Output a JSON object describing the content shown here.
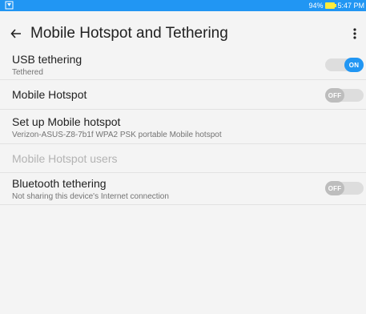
{
  "status_bar": {
    "battery": "94%",
    "time": "5:47 PM",
    "colors": {
      "background": "#2196f3",
      "battery": "#ffeb3b"
    }
  },
  "app_bar": {
    "title": "Mobile Hotspot and Tethering",
    "back_icon": "arrow-back-icon",
    "more_icon": "more-vert-icon"
  },
  "settings": {
    "usb_tethering": {
      "title": "USB tethering",
      "subtitle": "Tethered",
      "toggle_label": "ON",
      "enabled": true
    },
    "mobile_hotspot": {
      "title": "Mobile Hotspot",
      "toggle_label": "OFF",
      "enabled": false
    },
    "setup_hotspot": {
      "title": "Set up Mobile hotspot",
      "subtitle": "Verizon-ASUS-Z8-7b1f WPA2 PSK portable Mobile hotspot"
    },
    "hotspot_users": {
      "title": "Mobile Hotspot users",
      "disabled": true
    },
    "bluetooth_tethering": {
      "title": "Bluetooth tethering",
      "subtitle": "Not sharing this device's Internet connection",
      "toggle_label": "OFF",
      "enabled": false
    }
  },
  "colors": {
    "accent": "#2196f3",
    "toggle_off": "#bdbdbd"
  }
}
